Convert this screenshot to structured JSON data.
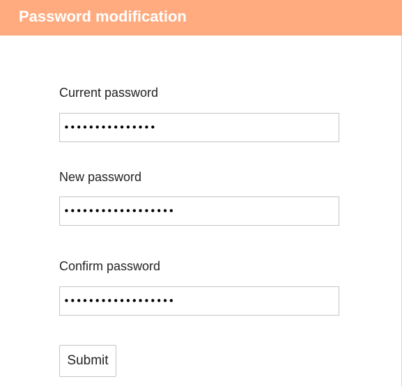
{
  "header": {
    "title": "Password modification",
    "color": "#ffab7f"
  },
  "form": {
    "current_password": {
      "label": "Current password",
      "value": "•••••••••••••••"
    },
    "new_password": {
      "label": "New password",
      "value": "••••••••••••••••••"
    },
    "confirm_password": {
      "label": "Confirm password",
      "value": "••••••••••••••••••"
    },
    "submit_label": "Submit"
  }
}
